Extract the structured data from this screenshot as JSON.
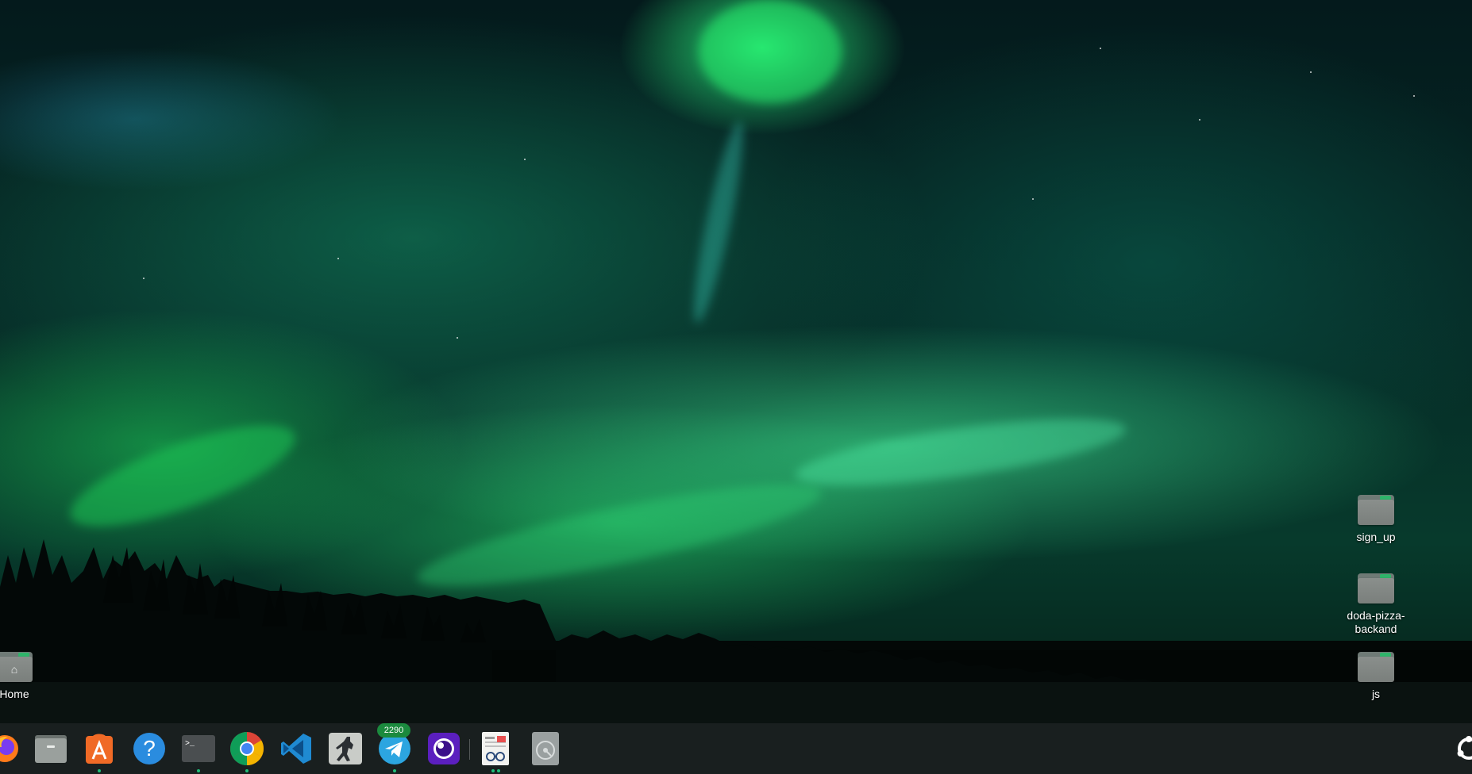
{
  "desktop": {
    "icons_right": [
      {
        "label": "sign_up"
      },
      {
        "label": "doda-pizza-backand"
      },
      {
        "label": "js"
      }
    ],
    "home": {
      "label": "Home"
    }
  },
  "dock": {
    "apps": [
      {
        "name": "firefox-icon",
        "running": false
      },
      {
        "name": "files-icon",
        "running": false
      },
      {
        "name": "software-center-icon",
        "running": true
      },
      {
        "name": "help-icon",
        "running": false
      },
      {
        "name": "terminal-icon",
        "running": true
      },
      {
        "name": "chrome-icon",
        "running": true
      },
      {
        "name": "vscode-icon",
        "running": false
      },
      {
        "name": "game-icon",
        "running": false
      },
      {
        "name": "telegram-icon",
        "running": true
      },
      {
        "name": "tor-browser-icon",
        "running": false
      },
      {
        "name": "document-viewer-icon",
        "running": true
      },
      {
        "name": "disk-utility-icon",
        "running": false
      }
    ],
    "telegram_badge": "2290",
    "help_glyph": "?",
    "terminal_glyph": ">_"
  }
}
